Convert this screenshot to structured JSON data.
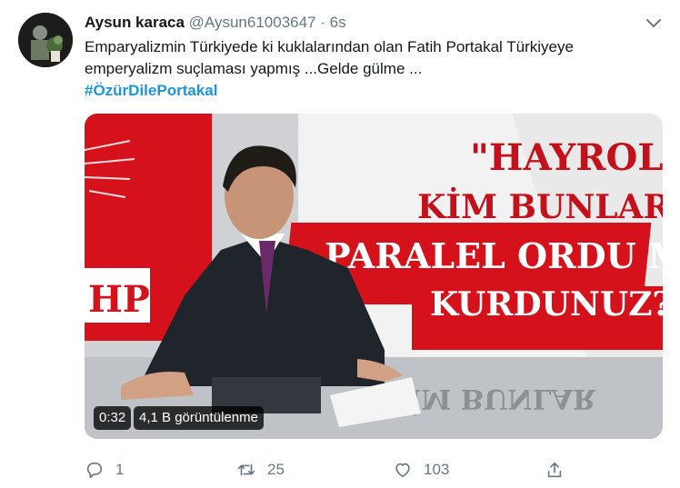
{
  "tweet": {
    "author_name": "Aysun karaca",
    "author_handle": "@Aysun61003647",
    "separator": "·",
    "time": "6s",
    "line1": "Emparyalizmin Türkiyede ki kuklalarından olan Fatih Portakal Türkiyeye",
    "line2": "emperyalizm suçlaması yapmış ...Gelde gülme ...",
    "hashtag": "#ÖzürDilePortakal"
  },
  "media": {
    "duration": "0:32",
    "views": "4,1 B görüntülenme",
    "caption_line1": "\"HAYROLA",
    "caption_line2": "KİM BUNLAR",
    "caption_line3": "PARALEL ORDU MU",
    "caption_line4": "KURDUNUZ?",
    "logo_fragment": "HP",
    "mirror_text": "KİM BUNLAR",
    "accent_red": "#e0101a"
  },
  "actions": {
    "replies": "1",
    "retweets": "25",
    "likes": "103"
  },
  "colors": {
    "link": "#1b95e0",
    "muted": "#657786",
    "text": "#14171a"
  }
}
